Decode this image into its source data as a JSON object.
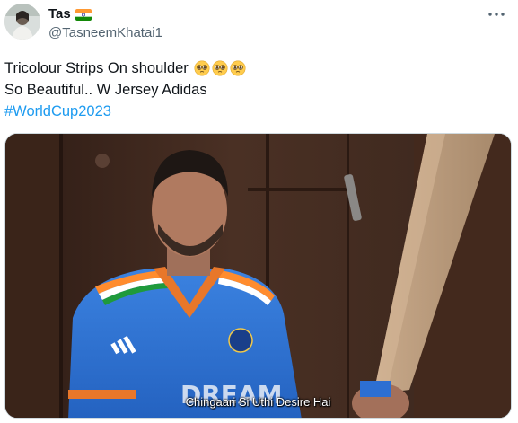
{
  "tweet": {
    "display_name": "Tas",
    "handle": "@TasneemKhatai1",
    "flag_icon": "india-flag-icon",
    "more_icon": "more-options-icon",
    "line1": "Tricolour Strips On shoulder",
    "line1_emojis": [
      "pleading-face-emoji",
      "pleading-face-emoji",
      "pleading-face-emoji"
    ],
    "line2": "So Beautiful.. W Jersey Adidas",
    "hashtag": "#WorldCup2023"
  },
  "media": {
    "type": "video-still",
    "subtitle": "Chingaari Si Uthi Desire Hai"
  },
  "colors": {
    "text": "#0f1419",
    "secondary": "#536471",
    "link": "#1d9bf0",
    "jersey": "#2f6fd0",
    "background_wood": "#3a261c"
  }
}
